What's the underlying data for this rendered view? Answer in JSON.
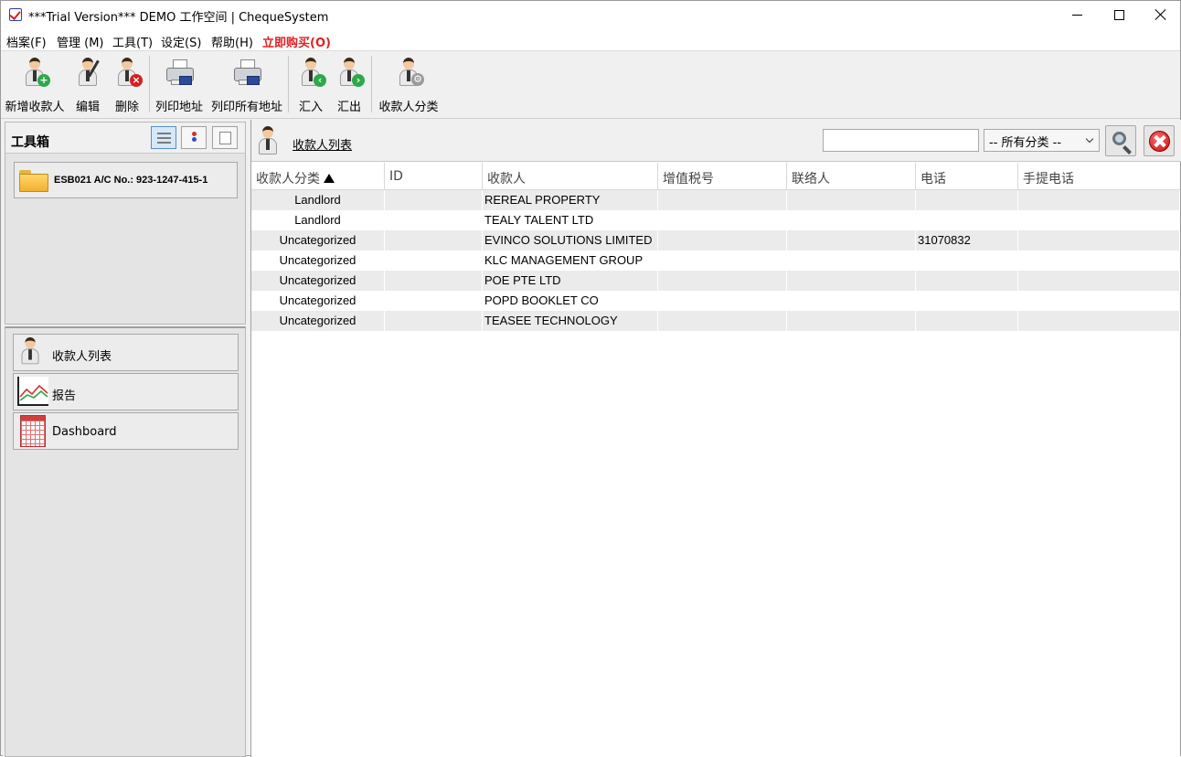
{
  "window": {
    "title": "***Trial Version*** DEMO 工作空间 | ChequeSystem"
  },
  "menu": [
    {
      "label": "档案(F)"
    },
    {
      "label": "管理 (M)"
    },
    {
      "label": "工具(T)"
    },
    {
      "label": "设定(S)"
    },
    {
      "label": "帮助(H)"
    },
    {
      "label": "立即购买(O)"
    }
  ],
  "toolbar": {
    "add_payee": "新增收款人",
    "edit": "编辑",
    "delete": "删除",
    "print_address": "列印地址",
    "print_all_address": "列印所有地址",
    "import": "汇入",
    "export": "汇出",
    "payee_category": "收款人分类"
  },
  "toolbox": {
    "title": "工具箱",
    "account": "ESB021 A/C No.: 923-1247-415-1"
  },
  "nav": [
    {
      "label": "收款人列表",
      "icon": "person-icon"
    },
    {
      "label": "报告",
      "icon": "chart-icon"
    },
    {
      "label": "Dashboard",
      "icon": "grid-icon"
    }
  ],
  "list": {
    "title": "收款人列表",
    "search_value": "",
    "category_selected": "-- 所有分类 --",
    "columns": [
      "收款人分类",
      "ID",
      "收款人",
      "增值税号",
      "联络人",
      "电话",
      "手提电话"
    ],
    "sort_column": "收款人分类",
    "rows": [
      {
        "category": "Landlord",
        "id": "",
        "payee": "REREAL PROPERTY",
        "vat": "",
        "contact": "",
        "phone": "",
        "mobile": ""
      },
      {
        "category": "Landlord",
        "id": "",
        "payee": "TEALY TALENT LTD",
        "vat": "",
        "contact": "",
        "phone": "",
        "mobile": ""
      },
      {
        "category": "Uncategorized",
        "id": "",
        "payee": "EVINCO SOLUTIONS LIMITED",
        "vat": "",
        "contact": "",
        "phone": "31070832",
        "mobile": ""
      },
      {
        "category": "Uncategorized",
        "id": "",
        "payee": "KLC MANAGEMENT GROUP",
        "vat": "",
        "contact": "",
        "phone": "",
        "mobile": ""
      },
      {
        "category": "Uncategorized",
        "id": "",
        "payee": "POE PTE LTD",
        "vat": "",
        "contact": "",
        "phone": "",
        "mobile": ""
      },
      {
        "category": "Uncategorized",
        "id": "",
        "payee": "POPD BOOKLET CO",
        "vat": "",
        "contact": "",
        "phone": "",
        "mobile": ""
      },
      {
        "category": "Uncategorized",
        "id": "",
        "payee": "TEASEE TECHNOLOGY",
        "vat": "",
        "contact": "",
        "phone": "",
        "mobile": ""
      }
    ]
  },
  "colors": {
    "buy_now": "#e02020",
    "row_alt": "#ebebeb",
    "add_badge": "#2da84a",
    "delete_badge": "#d32020"
  }
}
